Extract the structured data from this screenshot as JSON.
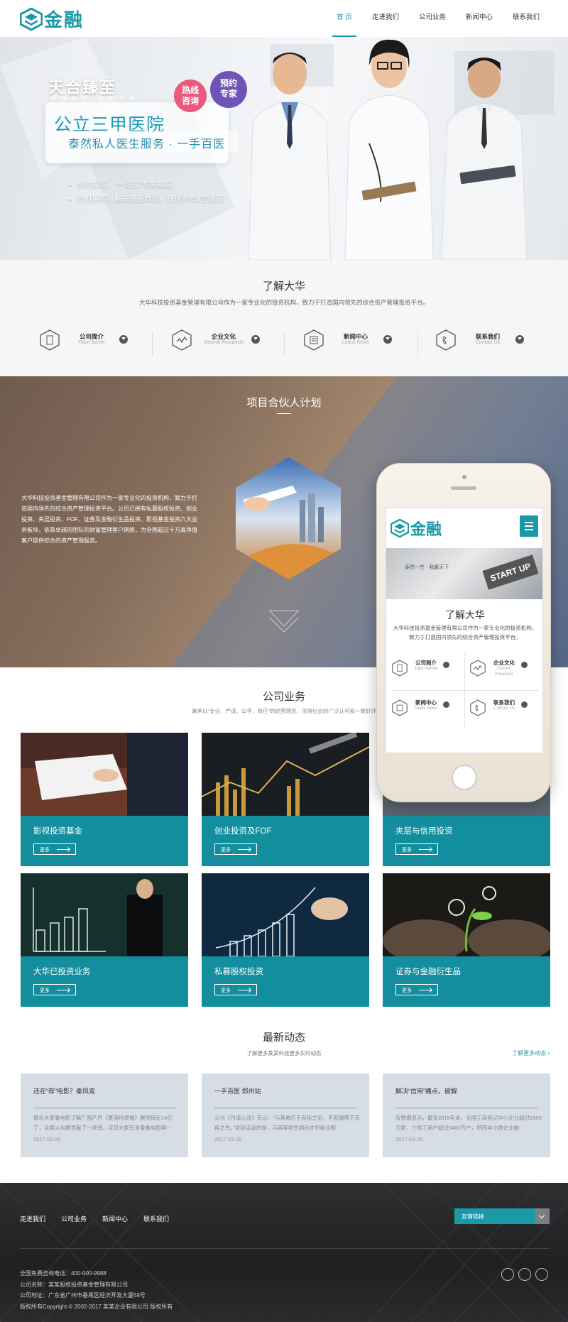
{
  "header": {
    "logo_text": "金融",
    "nav": [
      "首 页",
      "走进我们",
      "公司业务",
      "新闻中心",
      "联系我们"
    ],
    "active_index": 0
  },
  "hero": {
    "slogan_main": "天合臻至",
    "slogan_sub": "精 准 无 合 · 臻 于 至 善",
    "headline": "公立三甲医院",
    "subline": "泰然私人医生服务 · 一手百医",
    "badge_hotline": "热线咨询",
    "badge_appointment": "预约专家",
    "bullets": [
      "预约就诊、“一站式”专家就医",
      "针对重疾，解决就医难题，开通VIP绿色通道"
    ]
  },
  "about": {
    "title": "了解大华",
    "desc": "大华科技投资基金管理有限公司作为一家专业化的投资机构，致力于打造国内领先的综合资产管理投资平台。",
    "features": [
      {
        "title": "公司简介",
        "sub": "Talon tianhe",
        "icon": "building-icon"
      },
      {
        "title": "企业文化",
        "sub": "Vision& Prospects",
        "icon": "pulse-icon"
      },
      {
        "title": "新闻中心",
        "sub": "Latest News",
        "icon": "news-icon"
      },
      {
        "title": "联系我们",
        "sub": "Contact Us",
        "icon": "phone-icon"
      }
    ]
  },
  "partner": {
    "title": "项目合伙人计划",
    "text": "大华科技投资基金管理有限公司作为一家专业化的投资机构，致力于打造国内领先的综合资产管理投资平台。公司已拥有私募股权投资、创业投资、夹层投资、FOF、证券及金融衍生品投资、影视基金投资六大业务板块，依靠卓越的团队的财富管理客户网络，为全国超过十万高净值客户提供综合的资产管理服务。"
  },
  "phone": {
    "logo_text": "金融",
    "banner_text": "泰然一生 · 我赢天下",
    "banner_sign": "START UP",
    "title": "了解大华",
    "desc": "大华科技投资基金管理有限公司作为一家专业化的投资机构，致力于打造国内领先的综合资产管理投资平台。",
    "features": [
      {
        "title": "公司简介",
        "sub": "Talon tianhe"
      },
      {
        "title": "企业文化",
        "sub": "Vision& Prospects"
      },
      {
        "title": "新闻中心",
        "sub": "Latest News"
      },
      {
        "title": "联系我们",
        "sub": "Contact Us"
      }
    ]
  },
  "business": {
    "title": "公司业务",
    "desc": "秉承以“专业、严谨、公平、责任”的经营理念，深得社会的广泛认可和一致好评",
    "more_label": "更多",
    "items": [
      {
        "name": "影视投资基金"
      },
      {
        "name": "创业投资及FOF"
      },
      {
        "name": "夹层与信用投资"
      },
      {
        "name": "大华已投资业务"
      },
      {
        "name": "私募股权投资"
      },
      {
        "name": "证券与金融衍生品"
      }
    ]
  },
  "news": {
    "title": "最新动态",
    "desc": "了解更多某某科技更多实时动态",
    "more": "了解更多动态 ›",
    "items": [
      {
        "title": "还在“荐”电影？秦凤鸾",
        "text": "最近大家看电影了嘛？国产片《夏洛特烦恼》票房接近14亿了，全国人均都贡献了一块钱，可见大家有多爱看电影啊~",
        "date": "2017-03-26"
      },
      {
        "title": "一手百医 郑州站",
        "text": "元代《丹溪心法》有云：“与其救疗于有疾之后，不若摄养于无疾之先。”这段话说的是，与其等到生病后才积极诊断",
        "date": "2017-03-26"
      },
      {
        "title": "解决“信用”痛点，破解",
        "text": "有数据显示，截至2015年末，全国工商登记中小企业超过2000万家，个体工商户超过5400万户，然而中小微企业融",
        "date": "2017-03-26"
      }
    ]
  },
  "footer": {
    "links": [
      "走进我们",
      "公司业务",
      "新闻中心",
      "联系我们"
    ],
    "friend_links": "友情链接",
    "info": [
      "全国免费咨询电话：400-000-9988",
      "公司名称：某某股权投资基金管理有限公司",
      "公司地址：广东省广州市番禺区经济开发大厦58号",
      "版权所有Copyright © 2002-2017 某某企业有限公司 版权所有"
    ]
  },
  "colors": {
    "accent": "#1a9aa8",
    "card_teal": "#138e9e",
    "news_card": "#d6dde4",
    "footer_bg": "#2e2f31"
  }
}
